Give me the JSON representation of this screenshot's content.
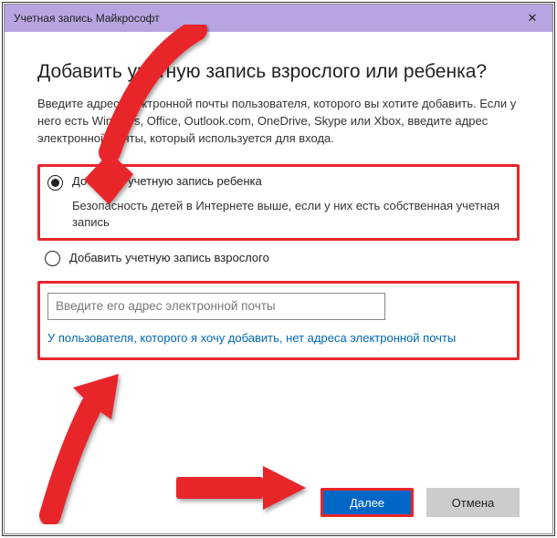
{
  "titlebar": {
    "title": "Учетная запись Майкрософт",
    "close_icon": "✕"
  },
  "heading": "Добавить учетную запись взрослого или ребенка?",
  "description": "Введите адрес электронной почты пользователя, которого вы хотите добавить. Если у него есть Windows, Office, Outlook.com, OneDrive, Skype или Xbox, введите адрес электронной почты, который используется для входа.",
  "radio_child": {
    "label": "Добавить учетную запись ребенка",
    "sub": "Безопасность детей в Интернете выше, если у них есть собственная учетная запись"
  },
  "radio_adult": {
    "label": "Добавить учетную запись взрослого"
  },
  "email": {
    "placeholder": "Введите его адрес электронной почты"
  },
  "no_email_link": "У пользователя, которого я хочу добавить, нет адреса электронной почты",
  "buttons": {
    "next": "Далее",
    "cancel": "Отмена"
  }
}
